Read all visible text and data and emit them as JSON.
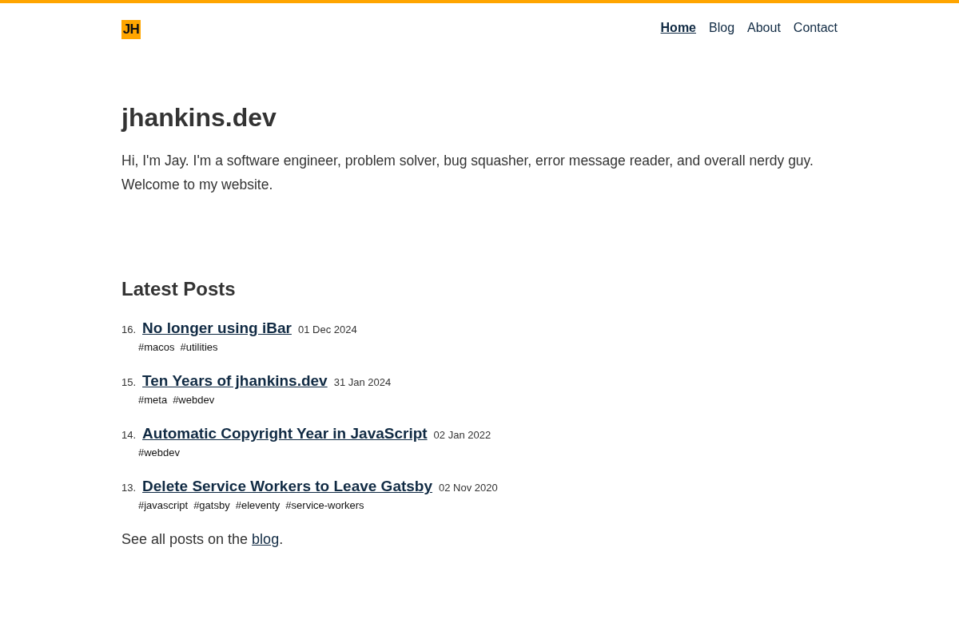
{
  "header": {
    "logo": "JH",
    "nav": [
      {
        "label": "Home",
        "selected": true
      },
      {
        "label": "Blog",
        "selected": false
      },
      {
        "label": "About",
        "selected": false
      },
      {
        "label": "Contact",
        "selected": false
      }
    ]
  },
  "hero": {
    "title": "jhankins.dev",
    "intro": "Hi, I'm Jay. I'm a software engineer, problem solver, bug squasher, error message reader, and overall nerdy guy. Welcome to my website."
  },
  "latest_posts": {
    "heading": "Latest Posts",
    "posts": [
      {
        "number": "16.",
        "title": "No longer using iBar",
        "date": "01 Dec 2024",
        "tags": [
          "#macos",
          "#utilities"
        ]
      },
      {
        "number": "15.",
        "title": "Ten Years of jhankins.dev",
        "date": "31 Jan 2024",
        "tags": [
          "#meta",
          "#webdev"
        ]
      },
      {
        "number": "14.",
        "title": "Automatic Copyright Year in JavaScript",
        "date": "02 Jan 2022",
        "tags": [
          "#webdev"
        ]
      },
      {
        "number": "13.",
        "title": "Delete Service Workers to Leave Gatsby",
        "date": "02 Nov 2020",
        "tags": [
          "#javascript",
          "#gatsby",
          "#eleventy",
          "#service-workers"
        ]
      }
    ],
    "footer": {
      "before": "See all posts on the ",
      "link": "blog",
      "after": "."
    }
  }
}
